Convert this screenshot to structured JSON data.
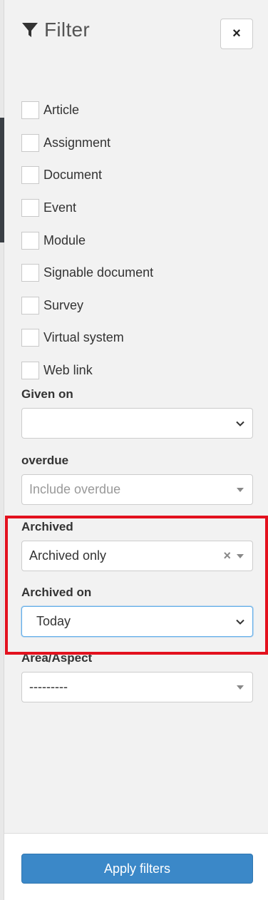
{
  "filter": {
    "title": "Filter",
    "close_label": "×",
    "types": [
      {
        "label": "Article",
        "checked": false
      },
      {
        "label": "Assignment",
        "checked": false
      },
      {
        "label": "Document",
        "checked": false
      },
      {
        "label": "Event",
        "checked": false
      },
      {
        "label": "Module",
        "checked": false
      },
      {
        "label": "Signable document",
        "checked": false
      },
      {
        "label": "Survey",
        "checked": false
      },
      {
        "label": "Virtual system",
        "checked": false
      },
      {
        "label": "Web link",
        "checked": false
      }
    ],
    "given_on": {
      "label": "Given on",
      "value": ""
    },
    "overdue": {
      "label": "overdue",
      "placeholder": "Include overdue"
    },
    "archived": {
      "label": "Archived",
      "value": "Archived only",
      "clear": "×"
    },
    "archived_on": {
      "label": "Archived on",
      "value": "Today"
    },
    "area_aspect": {
      "label": "Area/Aspect",
      "value": "---------"
    },
    "apply_label": "Apply filters"
  },
  "colors": {
    "accent": "#3b88c8",
    "highlight": "#e3111e",
    "panel_bg": "#f2f2f2"
  }
}
